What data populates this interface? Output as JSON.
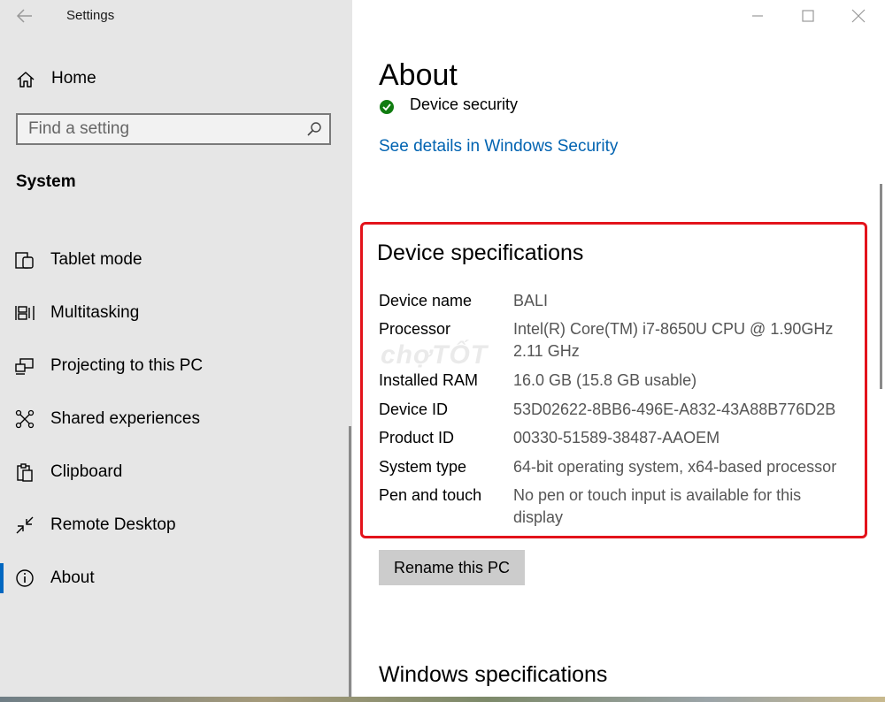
{
  "window": {
    "title": "Settings"
  },
  "sidebar": {
    "home_label": "Home",
    "search_placeholder": "Find a setting",
    "section_title": "System",
    "items": [
      {
        "label": "Tablet mode",
        "icon": "tablet-mode-icon"
      },
      {
        "label": "Multitasking",
        "icon": "multitasking-icon"
      },
      {
        "label": "Projecting to this PC",
        "icon": "projecting-icon"
      },
      {
        "label": "Shared experiences",
        "icon": "shared-experiences-icon"
      },
      {
        "label": "Clipboard",
        "icon": "clipboard-icon"
      },
      {
        "label": "Remote Desktop",
        "icon": "remote-desktop-icon"
      },
      {
        "label": "About",
        "icon": "info-icon",
        "active": true
      }
    ]
  },
  "main": {
    "title": "About",
    "security_item": "Device security",
    "security_link": "See details in Windows Security",
    "device_specs": {
      "heading": "Device specifications",
      "rows": [
        {
          "key": "Device name",
          "value": "BALI"
        },
        {
          "key": "Processor",
          "value": "Intel(R) Core(TM) i7-8650U CPU @ 1.90GHz 2.11 GHz"
        },
        {
          "key": "Installed RAM",
          "value": "16.0 GB (15.8 GB usable)"
        },
        {
          "key": "Device ID",
          "value": "53D02622-8BB6-496E-A832-43A88B776D2B"
        },
        {
          "key": "Product ID",
          "value": "00330-51589-38487-AAOEM"
        },
        {
          "key": "System type",
          "value": "64-bit operating system, x64-based processor"
        },
        {
          "key": "Pen and touch",
          "value": "No pen or touch input is available for this display"
        }
      ]
    },
    "rename_button": "Rename this PC",
    "windows_specs_heading": "Windows specifications"
  },
  "watermark": "chợTỐT",
  "colors": {
    "accent": "#0067c0",
    "link": "#0063b1",
    "highlight_border": "#e3131b",
    "security_ok": "#107c10"
  }
}
